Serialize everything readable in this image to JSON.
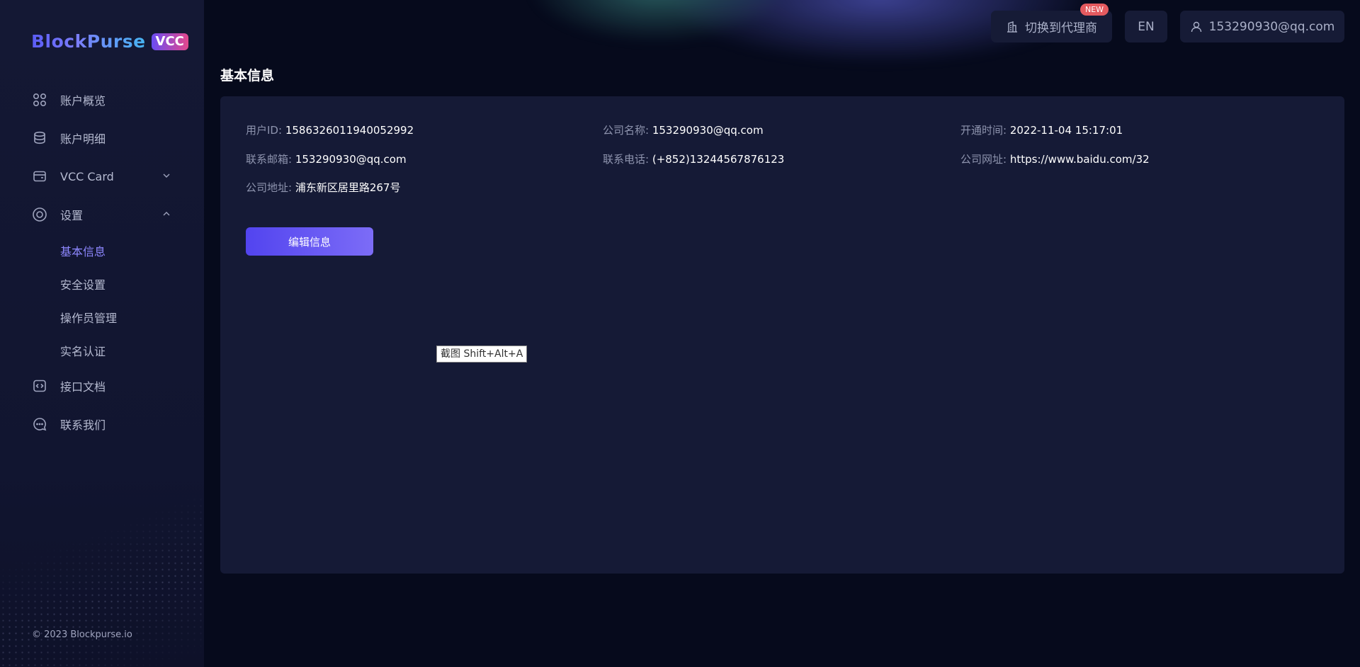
{
  "brand": {
    "name": "BlockPurse",
    "badge": "VCC"
  },
  "sidebar": {
    "items": [
      {
        "label": "账户概览",
        "icon": "grid-icon"
      },
      {
        "label": "账户明细",
        "icon": "database-icon"
      },
      {
        "label": "VCC Card",
        "icon": "wallet-icon",
        "expanded": false
      },
      {
        "label": "设置",
        "icon": "settings-icon",
        "expanded": true
      },
      {
        "label": "接口文档",
        "icon": "code-icon"
      },
      {
        "label": "联系我们",
        "icon": "chat-icon"
      }
    ],
    "settings_sub": [
      {
        "label": "基本信息",
        "active": true
      },
      {
        "label": "安全设置"
      },
      {
        "label": "操作员管理"
      },
      {
        "label": "实名认证"
      }
    ],
    "copyright": "© 2023 Blockpurse.io"
  },
  "topbar": {
    "switch_agent": "切换到代理商",
    "new_badge": "NEW",
    "language": "EN",
    "user": "153290930@qq.com"
  },
  "page": {
    "title": "基本信息"
  },
  "info": {
    "user_id": {
      "label": "用户ID:",
      "value": "1586326011940052992"
    },
    "company_name": {
      "label": "公司名称:",
      "value": "153290930@qq.com"
    },
    "open_time": {
      "label": "开通时间:",
      "value": "2022-11-04 15:17:01"
    },
    "email": {
      "label": "联系邮箱:",
      "value": "153290930@qq.com"
    },
    "phone": {
      "label": "联系电话:",
      "value": "(+852)13244567876123"
    },
    "website": {
      "label": "公司网址:",
      "value": "https://www.baidu.com/32"
    },
    "address": {
      "label": "公司地址:",
      "value": "浦东新区居里路267号"
    }
  },
  "actions": {
    "edit": "编辑信息"
  },
  "tooltip": "截图 Shift+Alt+A",
  "colors": {
    "accent": "#7b6cf6",
    "active_nav": "#8d87ff",
    "badge": "#e45a5f",
    "card_bg": "#151a36"
  }
}
